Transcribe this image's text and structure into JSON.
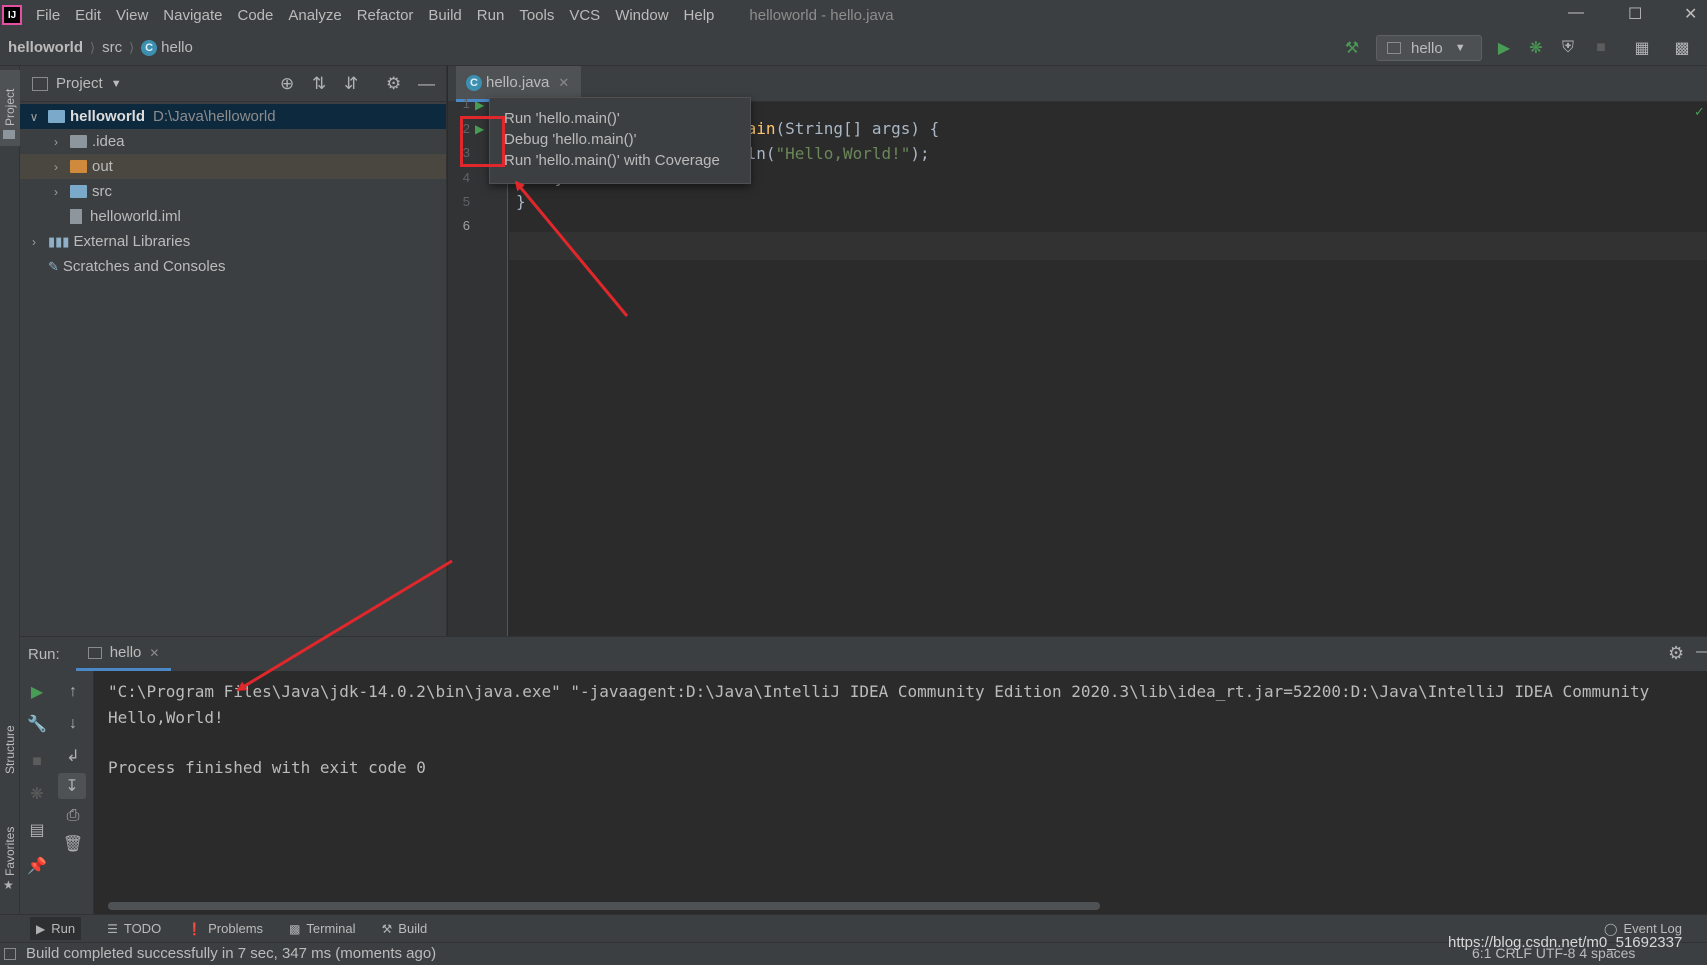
{
  "menubar": {
    "logo": "IJ",
    "items": [
      "File",
      "Edit",
      "View",
      "Navigate",
      "Code",
      "Analyze",
      "Refactor",
      "Build",
      "Run",
      "Tools",
      "VCS",
      "Window",
      "Help"
    ],
    "title": "helloworld - hello.java"
  },
  "navbar": {
    "project": "helloworld",
    "src": "src",
    "file": "hello",
    "run_config": "hello"
  },
  "left_stripe": {
    "project": "Project",
    "structure": "Structure",
    "favorites": "Favorites"
  },
  "project_panel": {
    "title": "Project",
    "tree": [
      {
        "label": "helloworld",
        "path": "D:\\Java\\helloworld"
      },
      {
        "label": ".idea"
      },
      {
        "label": "out"
      },
      {
        "label": "src"
      },
      {
        "label": "helloworld.iml"
      },
      {
        "label": "External Libraries"
      },
      {
        "label": "Scratches and Consoles"
      }
    ]
  },
  "editor": {
    "tab": "hello.java",
    "line_numbers": [
      "1",
      "2",
      "3",
      "4",
      "5",
      "6"
    ],
    "code": {
      "line2_fn": "main",
      "line2_rest": "(String[] args) {",
      "line3_pre": "tln(",
      "line3_str": "\"Hello,World!\"",
      "line3_post": ");",
      "line4": "    }",
      "line5": "}"
    }
  },
  "popup": {
    "items": [
      "Run 'hello.main()'",
      "Debug 'hello.main()'",
      "Run 'hello.main()' with Coverage"
    ]
  },
  "run_panel": {
    "label": "Run:",
    "tab": "hello",
    "console": [
      "\"C:\\Program Files\\Java\\jdk-14.0.2\\bin\\java.exe\" \"-javaagent:D:\\Java\\IntelliJ IDEA Community Edition 2020.3\\lib\\idea_rt.jar=52200:D:\\Java\\IntelliJ IDEA Community",
      "Hello,World!",
      "",
      "Process finished with exit code 0"
    ]
  },
  "bottom_tools": {
    "run": "Run",
    "todo": "TODO",
    "problems": "Problems",
    "terminal": "Terminal",
    "build": "Build",
    "event_log": "Event Log"
  },
  "status": {
    "message": "Build completed successfully in 7 sec, 347 ms (moments ago)",
    "watermark": "https://blog.csdn.net/m0_51692337",
    "right": "6:1  CRLF  UTF-8  4 spaces"
  }
}
